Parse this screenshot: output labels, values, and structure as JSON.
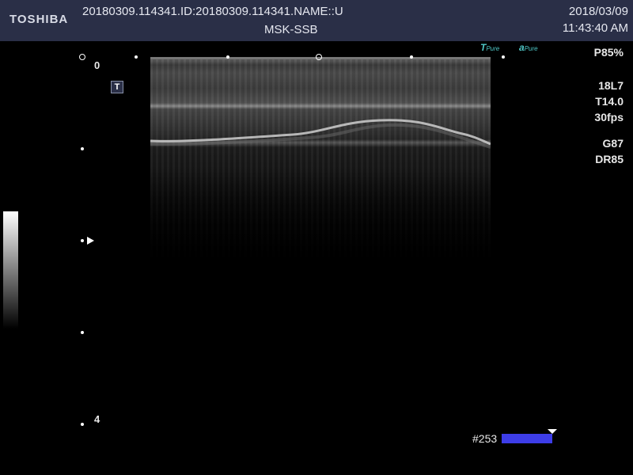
{
  "header": {
    "brand": "TOSHIBA",
    "patient_line": "20180309.114341.ID:20180309.114341.NAME::U",
    "preset": "MSK-SSB",
    "date": "2018/03/09",
    "time": "11:43:40 AM"
  },
  "logos": {
    "left": {
      "mark": "T",
      "text": "Pure"
    },
    "right": {
      "mark": "a",
      "text": "Pure"
    }
  },
  "params": {
    "power": "P85%",
    "probe": "18L7",
    "freq": "T14.0",
    "frame_rate": "30fps",
    "gain": "G87",
    "dynamic_range": "DR85"
  },
  "depth_scale": {
    "top": "0",
    "bottom": "4"
  },
  "t_marker": "T",
  "frame": {
    "label": "#253"
  },
  "colors": {
    "header_bg": "#2a2f47",
    "frame_bar": "#3d3de8",
    "logo": "#4fc8c8"
  }
}
